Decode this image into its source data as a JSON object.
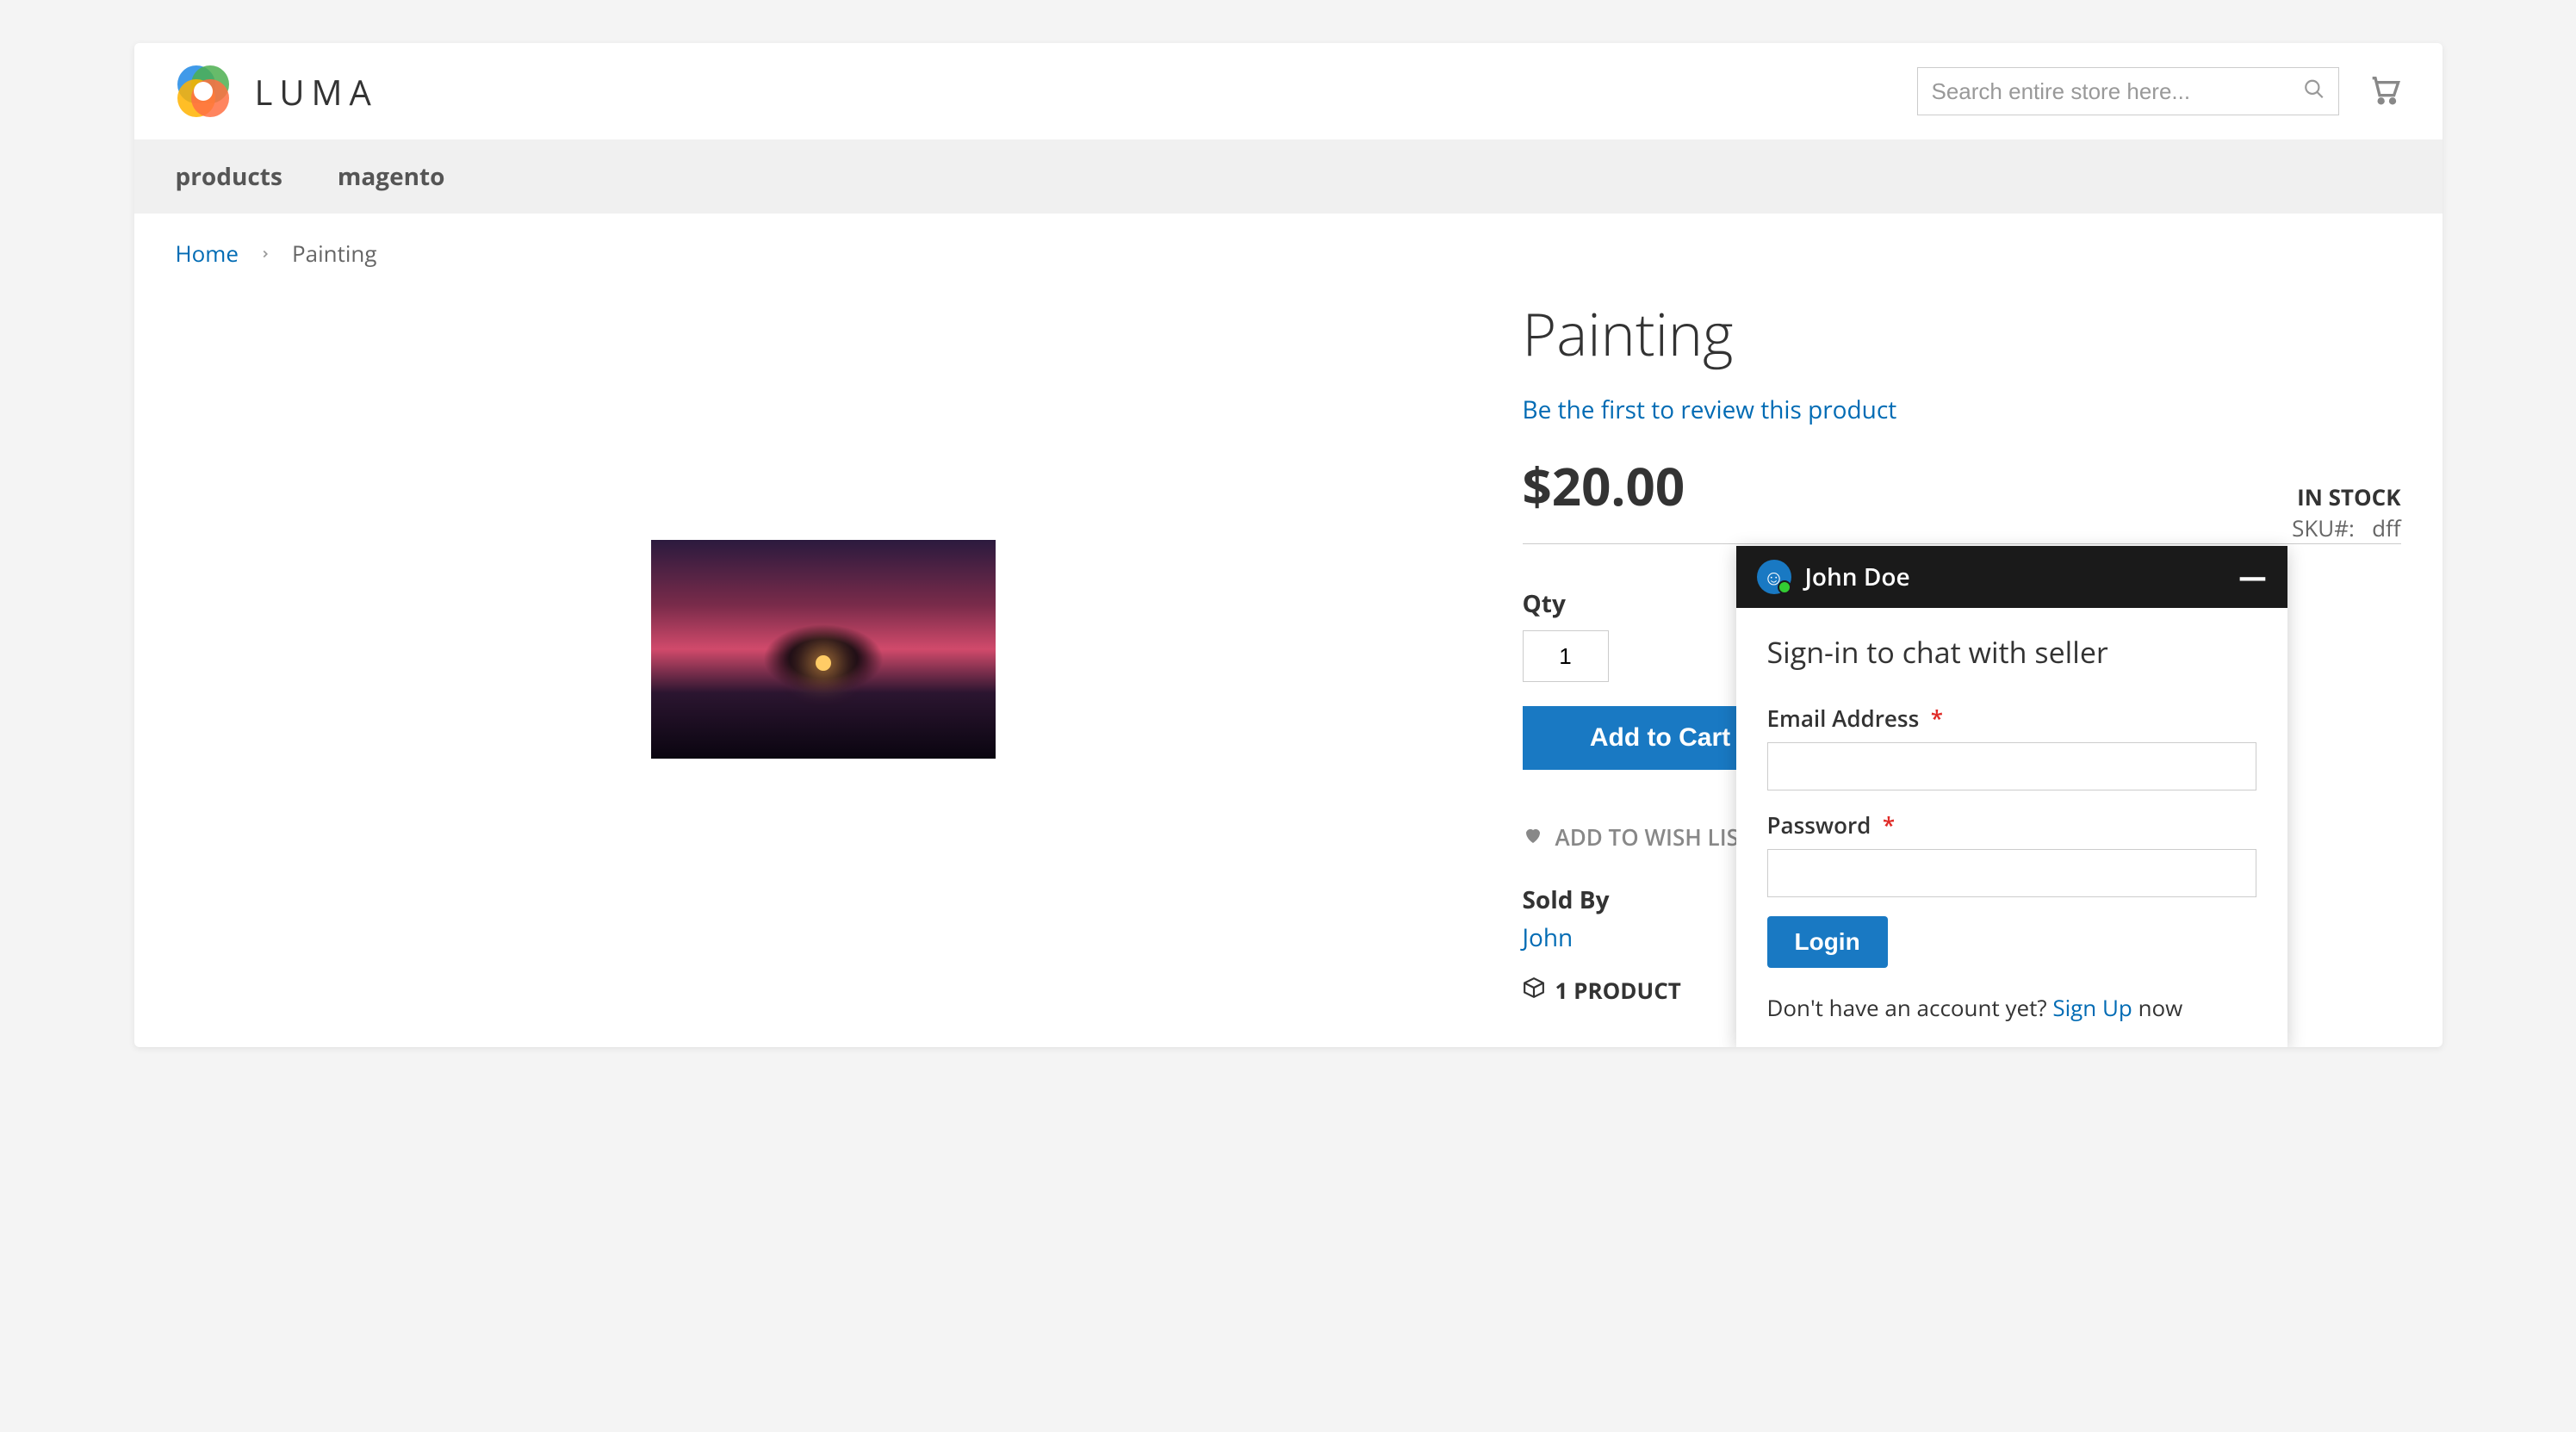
{
  "brand": "LUMA",
  "search": {
    "placeholder": "Search entire store here..."
  },
  "nav": {
    "items": [
      "products",
      "magento"
    ]
  },
  "breadcrumbs": {
    "home": "Home",
    "current": "Painting"
  },
  "product": {
    "title": "Painting",
    "review_link": "Be the first to review this product",
    "price": "$20.00",
    "stock": "IN STOCK",
    "sku_label": "SKU#:",
    "sku": "dff",
    "qty_label": "Qty",
    "qty_value": "1",
    "add_to_cart": "Add to Cart",
    "wishlist": "ADD TO WISH LIST",
    "soldby_label": "Sold By",
    "soldby_name": "John",
    "count": "1 PRODUCT"
  },
  "chat": {
    "name": "John Doe",
    "title": "Sign-in to chat with seller",
    "email_label": "Email Address",
    "password_label": "Password",
    "login": "Login",
    "signup_prefix": "Don't have an account yet? ",
    "signup_link": "Sign Up",
    "signup_suffix": " now"
  }
}
